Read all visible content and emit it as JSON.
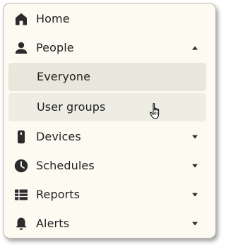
{
  "menu": {
    "items": [
      {
        "label": "Home",
        "icon": "home-icon"
      },
      {
        "label": "People",
        "icon": "person-icon",
        "expanded": true,
        "children": [
          {
            "label": "Everyone"
          },
          {
            "label": "User groups"
          }
        ]
      },
      {
        "label": "Devices",
        "icon": "device-icon"
      },
      {
        "label": "Schedules",
        "icon": "clock-icon"
      },
      {
        "label": "Reports",
        "icon": "list-icon"
      },
      {
        "label": "Alerts",
        "icon": "bell-icon"
      }
    ]
  },
  "colors": {
    "panel_background": "#fdfaf2",
    "selected_background": "#e9e7dc",
    "hover_background": "#eeede3",
    "text": "#1f1f1f"
  }
}
